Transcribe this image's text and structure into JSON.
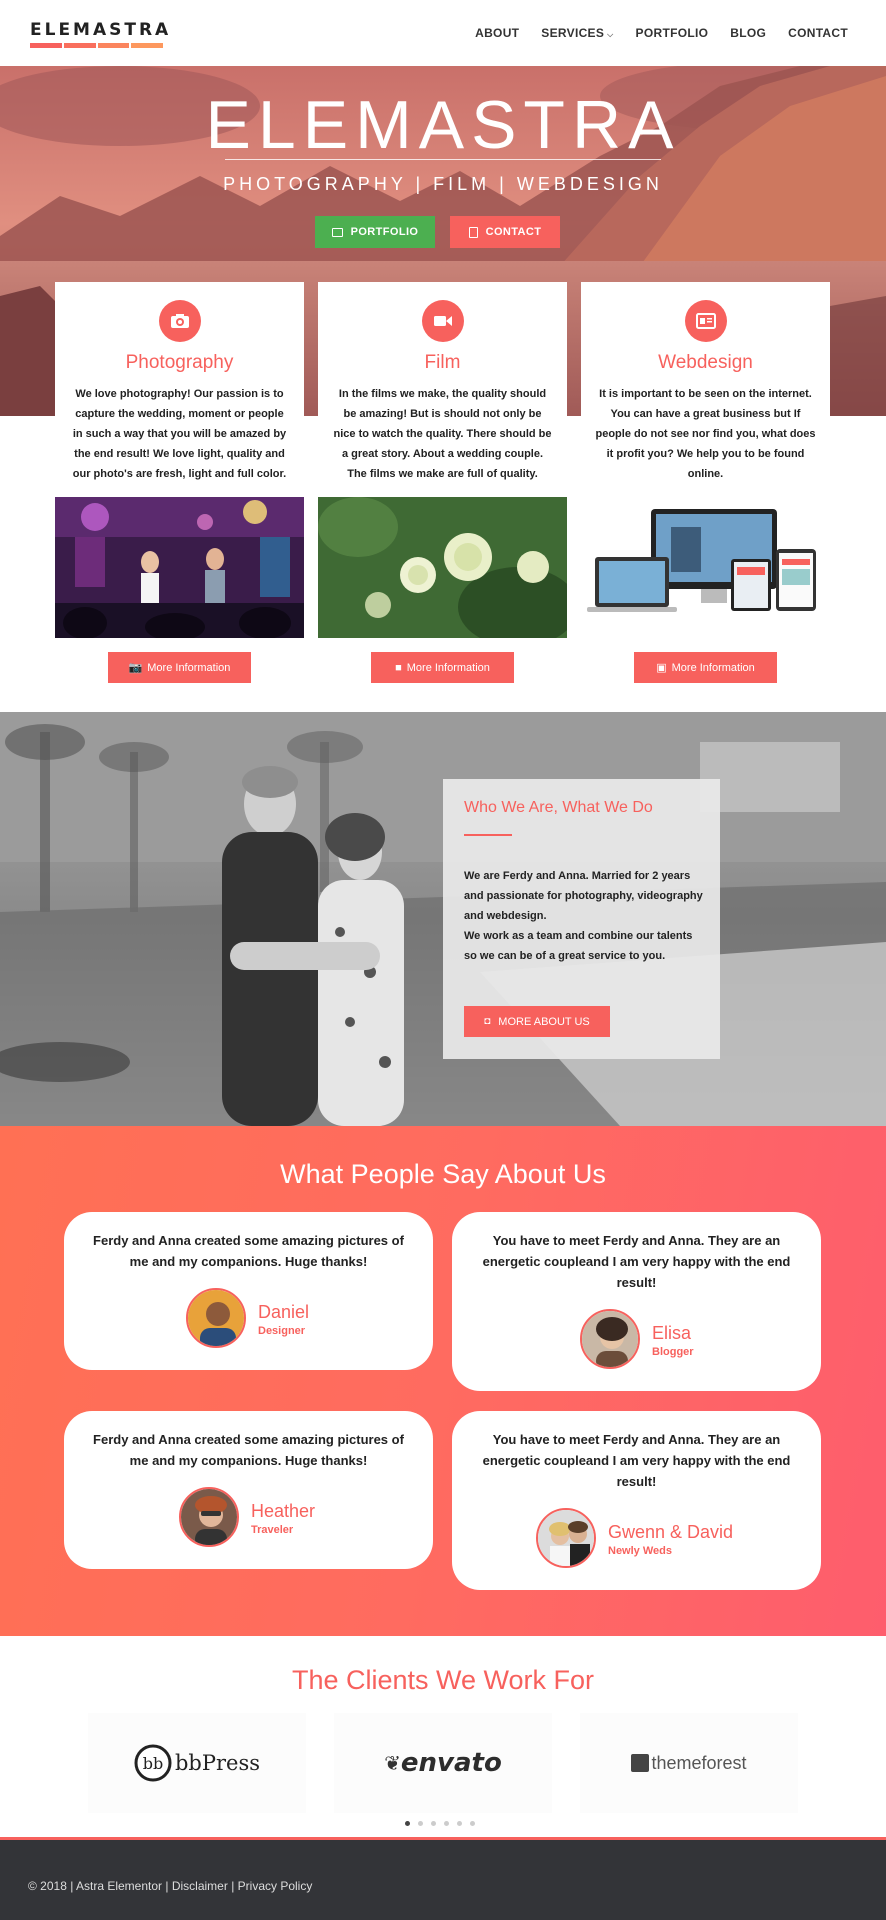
{
  "header": {
    "logo": "ELEMASTRA",
    "logo_colors": [
      "#f7615d",
      "#f96f5d",
      "#fb855e",
      "#fd985e"
    ],
    "nav": [
      "ABOUT",
      "SERVICES",
      "PORTFOLIO",
      "BLOG",
      "CONTACT"
    ]
  },
  "hero": {
    "title": "ELEMASTRA",
    "subtitle": "PHOTOGRAPHY | FILM | WEBDESIGN",
    "portfolio_button": "PORTFOLIO",
    "contact_button": "CONTACT"
  },
  "services": [
    {
      "icon": "camera-icon",
      "title": "Photography",
      "text": "We love photography! Our passion is to capture the wedding, moment or people in such a way that you will be amazed by the end result! We love light, quality and our photo's are fresh, light and full color.",
      "button": "More Information"
    },
    {
      "icon": "video-camera-icon",
      "title": "Film",
      "text": "In the films we make, the quality should be amazing! But is should not only be nice to watch the quality. There should be a great story. About a wedding couple. The films we make are full of quality.",
      "button": "More Information"
    },
    {
      "icon": "id-card-icon",
      "title": "Webdesign",
      "text": "It is important to be seen on the internet. You can have a great business but If people do not see nor find you, what does it profit you? We help you to be found online.",
      "button": "More Information"
    }
  ],
  "about": {
    "title": "Who We Are, What We Do",
    "p1": "We are Ferdy and Anna. Married for 2 years and passionate for photography, videography and webdesign.",
    "p2": "We work as a team and combine our talents so we can be of a great service to you.",
    "button": "MORE ABOUT US"
  },
  "testimonials": {
    "title": "What People Say About Us",
    "items": [
      {
        "quote": "Ferdy and Anna created some amazing pictures of me and my companions. Huge thanks!",
        "name": "Daniel",
        "role": "Designer"
      },
      {
        "quote": "You have to meet Ferdy and Anna. They are an energetic coupleand I am very happy with the end result!",
        "name": "Elisa",
        "role": "Blogger"
      },
      {
        "quote": "Ferdy and Anna created some amazing pictures of me and my companions. Huge thanks!",
        "name": "Heather",
        "role": "Traveler"
      },
      {
        "quote": "You have to meet Ferdy and Anna. They are an energetic coupleand I am very happy with the end result!",
        "name": "Gwenn & David",
        "role": "Newly Weds"
      }
    ]
  },
  "clients": {
    "title": "The Clients We Work For",
    "logos": [
      "bbPress",
      "envato",
      "themeforest"
    ],
    "slide_count": 6,
    "active_slide": 1
  },
  "footer": {
    "copyright": "© 2018",
    "site": "Astra Elementor",
    "disclaimer": "Disclaimer",
    "privacy": "Privacy Policy",
    "separator": " | "
  },
  "colors": {
    "accent": "#f7615d",
    "green": "#4caf50",
    "footer": "#333438"
  }
}
